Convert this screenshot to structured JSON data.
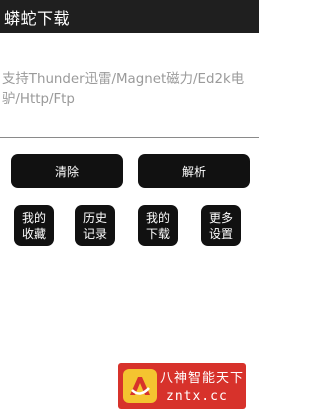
{
  "app": {
    "title": "蟒蛇下载"
  },
  "input": {
    "placeholder": "支持Thunder迅雷/Magnet磁力/Ed2k电驴/Http/Ftp"
  },
  "buttons": {
    "clear": "清除",
    "parse": "解析",
    "favorites": "我的收藏",
    "history": "历史记录",
    "downloads": "我的下载",
    "settings": "更多设置"
  },
  "watermark": {
    "line1": "八神智能天下",
    "line2": "zntx.cc"
  },
  "colors": {
    "appbar": "#1f1f1f",
    "button": "#111111",
    "placeholder": "#9a9a9a",
    "watermark_bg": "#d7322b"
  }
}
